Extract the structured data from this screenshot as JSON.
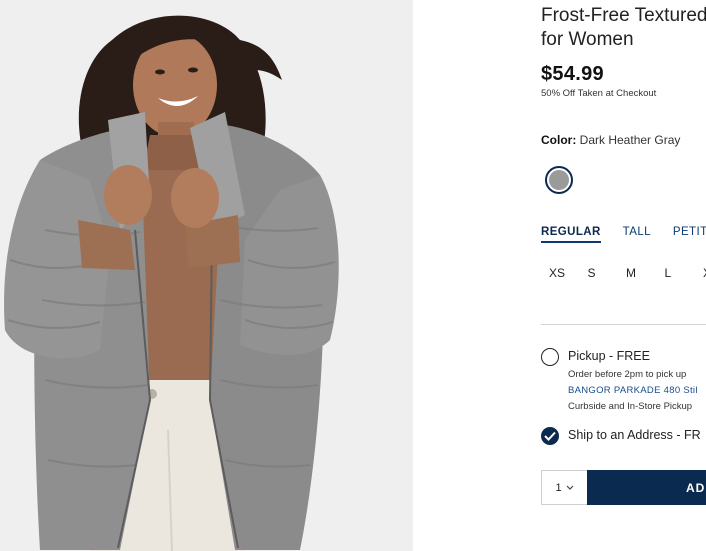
{
  "product": {
    "title": "Frost-Free Textured\nfor Women",
    "price": "$54.99",
    "discount": "50% Off Taken at Checkout",
    "color_label": "Color:",
    "color_value": "Dark Heather Gray",
    "swatch_color": "#9a9a9a"
  },
  "fits": [
    {
      "label": "REGULAR",
      "active": true
    },
    {
      "label": "TALL",
      "active": false
    },
    {
      "label": "PETITE",
      "active": false
    }
  ],
  "sizes": [
    "XS",
    "S",
    "M",
    "L",
    "X"
  ],
  "fulfillment": {
    "pickup_label": "Pickup - FREE",
    "pickup_note": "Order before 2pm to pick up",
    "store": "BANGOR PARKADE 480 Stil",
    "curbside": "Curbside and In-Store Pickup",
    "ship_label": "Ship to an Address - FR",
    "ship_selected": true
  },
  "cart": {
    "quantity": "1",
    "add_label": "AD"
  },
  "colors": {
    "navy": "#0b2a4f",
    "link_blue": "#1a4d8c"
  }
}
